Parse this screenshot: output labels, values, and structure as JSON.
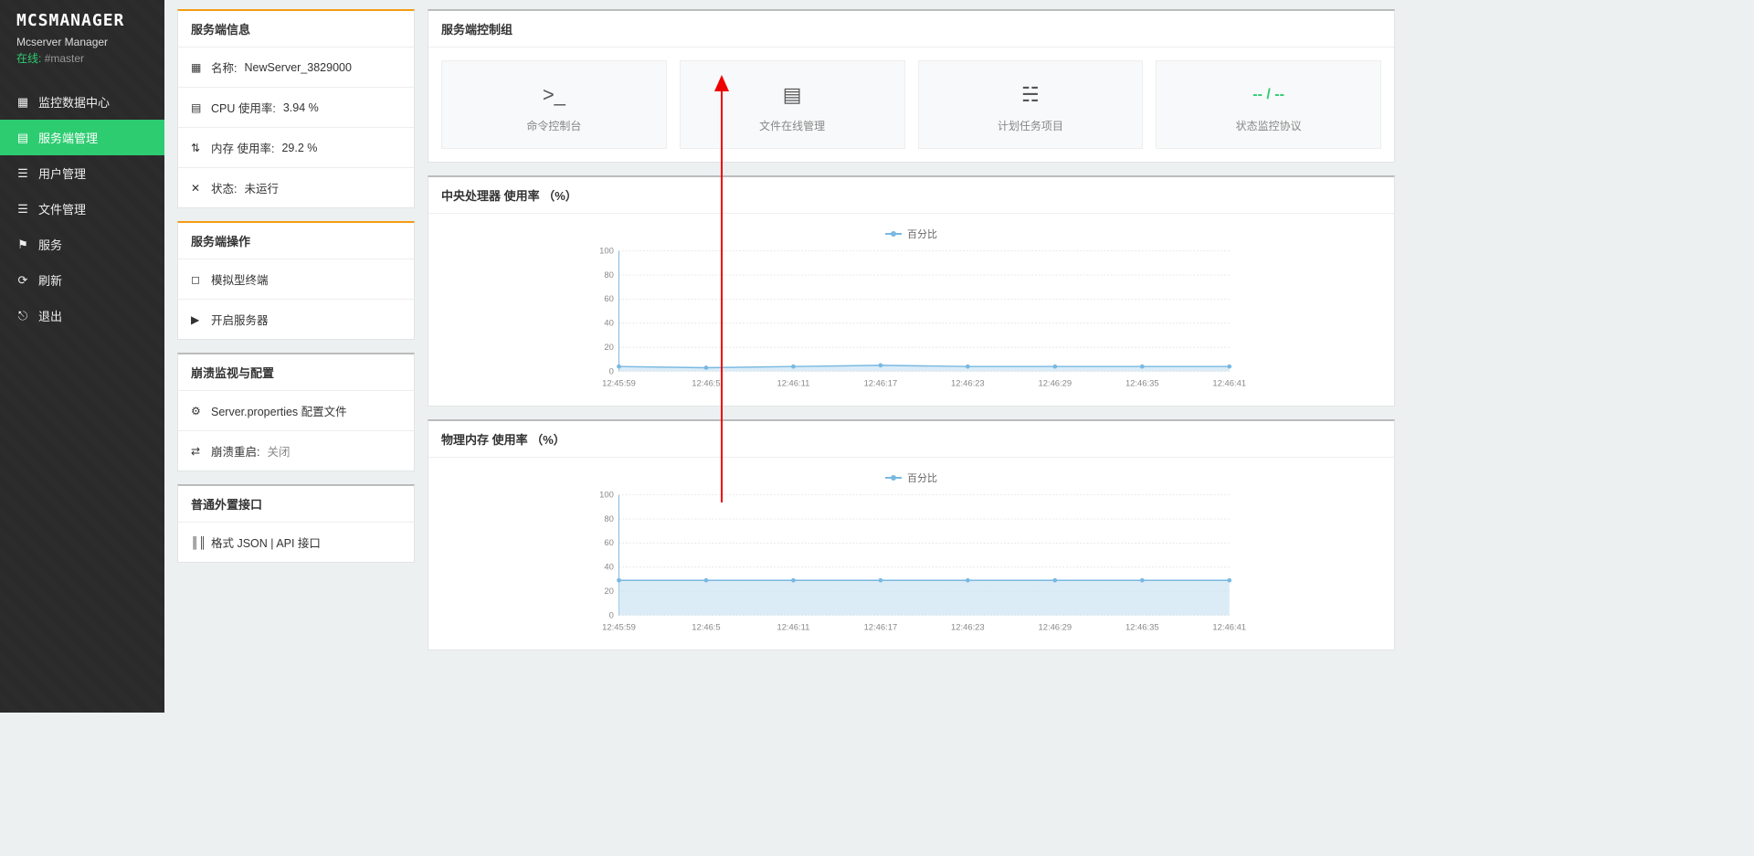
{
  "app": {
    "logo": "MCSMANAGER",
    "subtitle": "Mcserver Manager",
    "status_online_label": "在线:",
    "status_master": "#master"
  },
  "sidebar": {
    "items": [
      {
        "label": "监控数据中心"
      },
      {
        "label": "服务端管理"
      },
      {
        "label": "用户管理"
      },
      {
        "label": "文件管理"
      },
      {
        "label": "服务"
      },
      {
        "label": "刷新"
      },
      {
        "label": "退出"
      }
    ]
  },
  "info_panel": {
    "title": "服务端信息",
    "name_label": "名称:",
    "name_value": "NewServer_3829000",
    "cpu_label": "CPU 使用率:",
    "cpu_value": "3.94 %",
    "mem_label": "内存 使用率:",
    "mem_value": "29.2 %",
    "state_label": "状态:",
    "state_value": "未运行"
  },
  "ops_panel": {
    "title": "服务端操作",
    "terminal": "模拟型终端",
    "start": "开启服务器"
  },
  "crash_panel": {
    "title": "崩溃监视与配置",
    "props": "Server.properties 配置文件",
    "restart_label": "崩溃重启:",
    "restart_value": "关闭"
  },
  "api_panel": {
    "title": "普通外置接口",
    "json_api": "格式 JSON | API 接口"
  },
  "control_panel": {
    "title": "服务端控制组",
    "tiles": [
      {
        "label": "命令控制台"
      },
      {
        "label": "文件在线管理"
      },
      {
        "label": "计划任务项目"
      },
      {
        "label": "状态监控协议",
        "value": "-- / --"
      }
    ]
  },
  "cpu_chart_title": "中央处理器 使用率 （%）",
  "mem_chart_title": "物理内存 使用率 （%）",
  "chart_legend": "百分比",
  "chart_data": [
    {
      "type": "line",
      "title": "中央处理器 使用率 （%）",
      "ylabel": "%",
      "ylim": [
        0,
        100
      ],
      "yticks": [
        0,
        20,
        40,
        60,
        80,
        100
      ],
      "x": [
        "12:45:59",
        "12:46:5",
        "12:46:11",
        "12:46:17",
        "12:46:23",
        "12:46:29",
        "12:46:35",
        "12:46:41"
      ],
      "series": [
        {
          "name": "百分比",
          "values": [
            4,
            3,
            4,
            5,
            4,
            4,
            4,
            4
          ]
        }
      ]
    },
    {
      "type": "line",
      "title": "物理内存 使用率 （%）",
      "ylabel": "%",
      "ylim": [
        0,
        100
      ],
      "yticks": [
        0,
        20,
        40,
        60,
        80,
        100
      ],
      "x": [
        "12:45:59",
        "12:46:5",
        "12:46:11",
        "12:46:17",
        "12:46:23",
        "12:46:29",
        "12:46:35",
        "12:46:41"
      ],
      "series": [
        {
          "name": "百分比",
          "values": [
            29,
            29,
            29,
            29,
            29,
            29,
            29,
            29
          ]
        }
      ]
    }
  ]
}
